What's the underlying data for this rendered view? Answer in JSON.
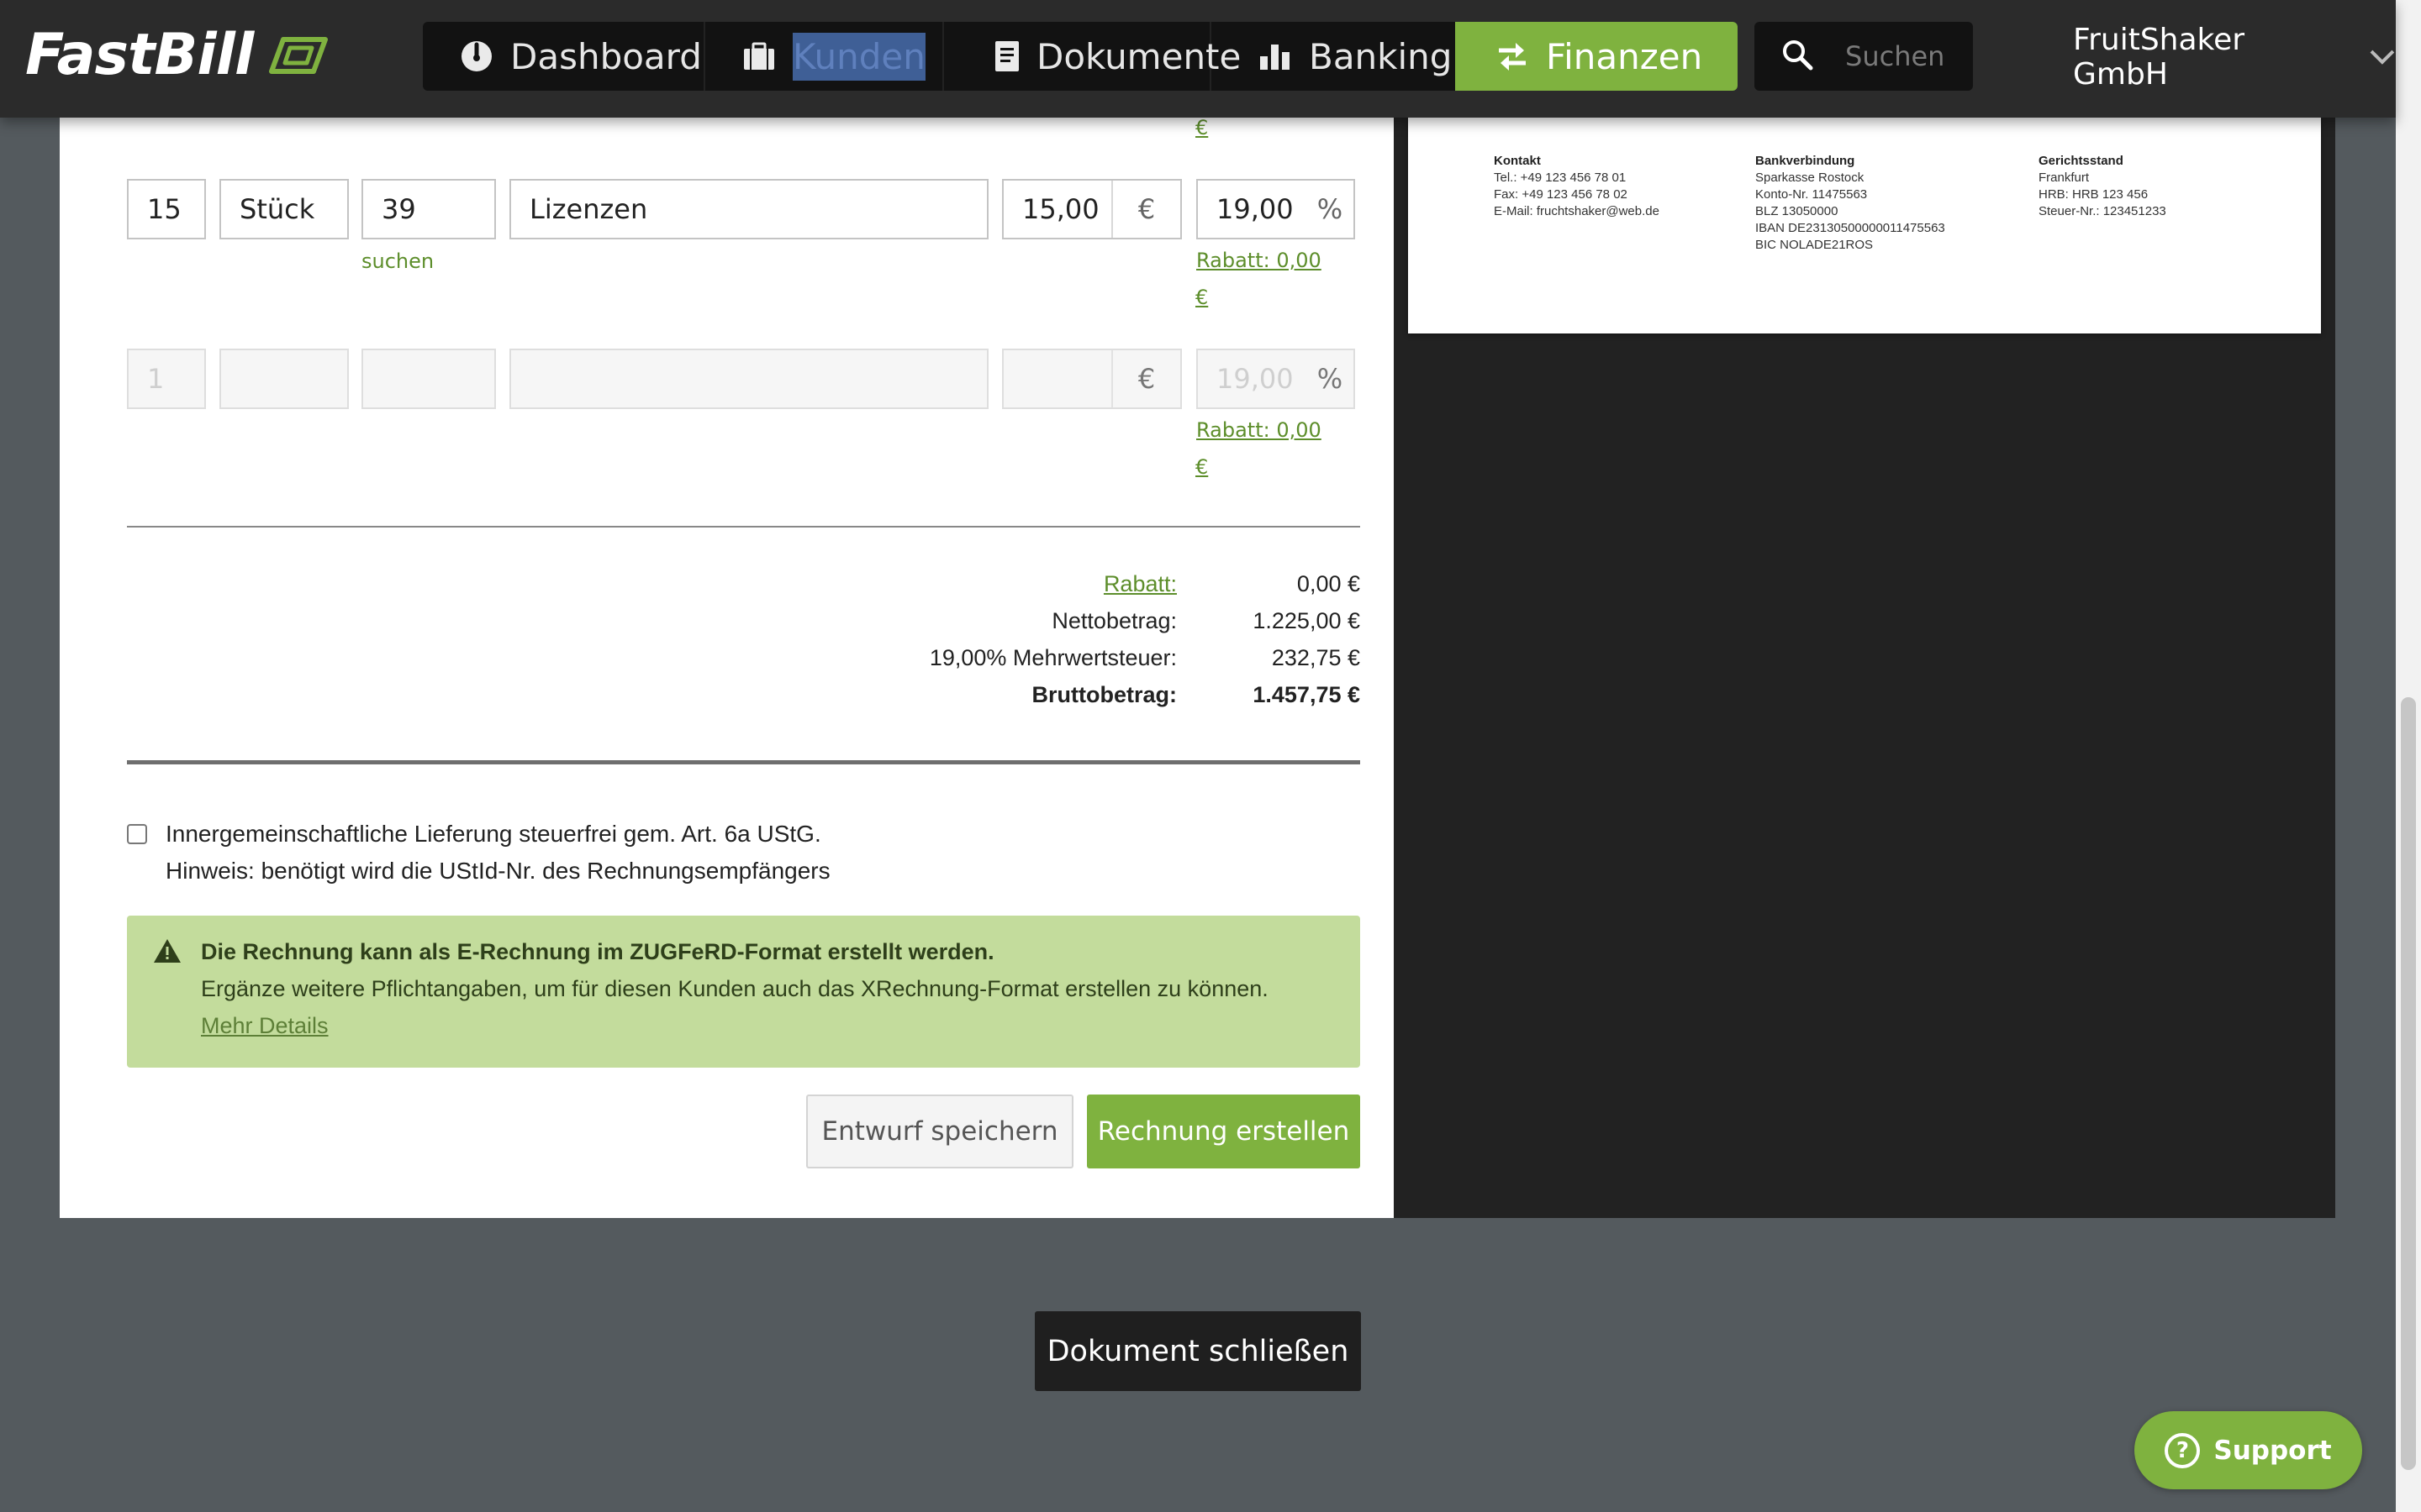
{
  "app": {
    "logo_text": "FastBill"
  },
  "nav": {
    "items": [
      {
        "label": "Dashboard",
        "icon": "dashboard-gauge-icon"
      },
      {
        "label": "Kunden",
        "icon": "briefcase-icon"
      },
      {
        "label": "Dokumente",
        "icon": "document-icon"
      },
      {
        "label": "Banking",
        "icon": "bar-chart-icon"
      },
      {
        "label": "Finanzen",
        "icon": "exchange-arrows-icon"
      }
    ],
    "active": "Finanzen"
  },
  "search": {
    "placeholder": "Suchen"
  },
  "account": {
    "company": "FruitShaker GmbH"
  },
  "positions": {
    "top_cut_euro": "€",
    "rows": [
      {
        "qty": "15",
        "unit": "Stück",
        "article": "39",
        "description": "Lizenzen",
        "price": "15,00",
        "currency": "€",
        "tax": "19,00",
        "tax_unit": "%",
        "search_hint": "suchen",
        "discount_link": "Rabatt: 0,00",
        "discount_euro": "€"
      }
    ],
    "empty_row": {
      "qty_placeholder": "1",
      "currency": "€",
      "tax_placeholder": "19,00",
      "tax_unit": "%",
      "discount_link": "Rabatt: 0,00",
      "discount_euro": "€"
    }
  },
  "totals": {
    "discount_label": "Rabatt:",
    "discount_value": "0,00 €",
    "net_label": "Nettobetrag:",
    "net_value": "1.225,00 €",
    "vat_label": "19,00% Mehrwertsteuer:",
    "vat_value": "232,75 €",
    "gross_label": "Bruttobetrag:",
    "gross_value": "1.457,75 €"
  },
  "eu_delivery": {
    "label": "Innergemeinschaftliche Lieferung steuerfrei gem. Art. 6a UStG.",
    "hint": "Hinweis: benötigt wird die UStId-Nr. des Rechnungsempfängers",
    "checked": false
  },
  "notice": {
    "icon": "warning-triangle-icon",
    "title": "Die Rechnung kann als E-Rechnung im ZUGFeRD-Format erstellt werden.",
    "text": "Ergänze weitere Pflichtangaben, um für diesen Kunden auch das XRechnung-Format erstellen zu können.",
    "link": "Mehr Details"
  },
  "actions": {
    "draft_label": "Entwurf speichern",
    "create_label": "Rechnung erstellen"
  },
  "preview": {
    "contact": {
      "heading": "Kontakt",
      "lines": [
        "Tel.: +49 123 456 78 01",
        "Fax: +49 123 456 78 02",
        "E-Mail: fruchtshaker@web.de"
      ]
    },
    "bank": {
      "heading": "Bankverbindung",
      "lines": [
        "Sparkasse Rostock",
        "Konto-Nr. 11475563",
        "BLZ 13050000",
        "IBAN DE23130500000011475563",
        "BIC NOLADE21ROS"
      ]
    },
    "court": {
      "heading": "Gerichtsstand",
      "lines": [
        "Frankfurt",
        "HRB: HRB 123 456",
        "Steuer-Nr.: 123451233"
      ]
    }
  },
  "close_label": "Dokument schließen",
  "support": {
    "label": "Support",
    "icon": "question-circle-icon"
  },
  "colors": {
    "accent": "#7fb23f",
    "topbar": "#2b2b2b",
    "background": "#545a5e",
    "notice_bg": "#c3dc9c"
  }
}
